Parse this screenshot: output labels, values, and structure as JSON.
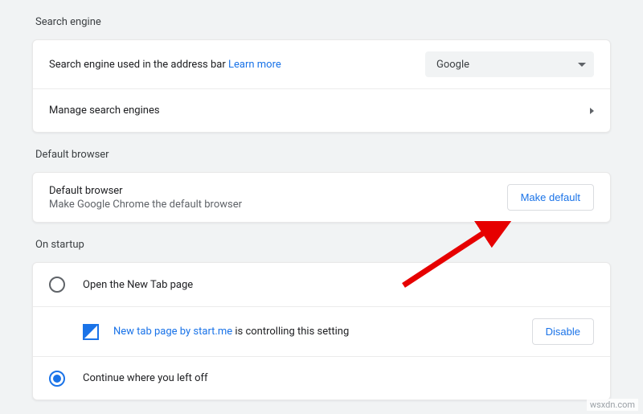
{
  "searchEngine": {
    "title": "Search engine",
    "row1_label": "Search engine used in the address bar",
    "row1_link": "Learn more",
    "row1_value": "Google",
    "row2_label": "Manage search engines"
  },
  "defaultBrowser": {
    "title": "Default browser",
    "primary": "Default browser",
    "secondary": "Make Google Chrome the default browser",
    "button": "Make default"
  },
  "startup": {
    "title": "On startup",
    "opt1": "Open the New Tab page",
    "ext_link": "New tab page by start.me",
    "ext_rest": " is controlling this setting",
    "ext_button": "Disable",
    "opt2": "Continue where you left off"
  },
  "watermark": "wsxdn.com"
}
